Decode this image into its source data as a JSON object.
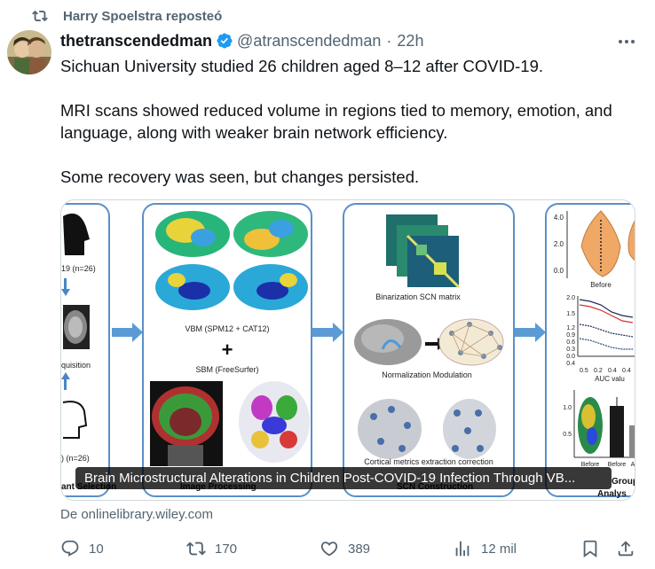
{
  "repost": {
    "text": "Harry Spoelstra reposteó",
    "icon": "repost-icon"
  },
  "author": {
    "name": "thetranscendedman",
    "handle": "@atranscendedman",
    "separator": "·",
    "time": "22h",
    "verified_color": "#1d9bf0"
  },
  "tweet": {
    "line1": "Sichuan University studied 26 children aged 8–12 after COVID-19.",
    "line2": "MRI scans showed reduced volume in regions tied to memory, emotion, and language, along with weaker brain network efficiency.",
    "line3": "Some recovery was seen, but changes persisted."
  },
  "media": {
    "caption": "Brain Microstructural Alterations in Children Post-COVID-19 Infection Through VB...",
    "figure": {
      "panel1_cohort": "19 (n=26)",
      "panel1_acquisition": "quisition",
      "panel1_n2": ") (n=26)",
      "panel1_footer": "ant Selection",
      "vbm_label": "VBM (SPM12 + CAT12)",
      "plus": "+",
      "sbm_label": "SBM (FreeSurfer)",
      "panel2_footer": "Image Processing",
      "binarization_label": "Binarization SCN matrix",
      "normalization_label": "Normalization Modulation",
      "cortical_label": "Cortical metrics extraction correction",
      "panel3_footer": "SCN Construction",
      "violin_yticks": [
        "4.0",
        "2.0",
        "0.0"
      ],
      "violin_xlabel": "Before",
      "line_yticks": [
        "2.0",
        "1.5",
        "1.2",
        "0.9",
        "0.6",
        "0.3",
        "0.0",
        "0.4"
      ],
      "line_xticks": [
        "0.5",
        "0.2",
        "0.4",
        "0.4"
      ],
      "auc_label": "AUC valu",
      "bar_yticks": [
        "1.0",
        "0.5"
      ],
      "bar_xlabels": [
        "Before",
        "Before",
        "A"
      ],
      "panel4_footer_1": "Group The",
      "panel4_footer_2": "Analys"
    }
  },
  "source": {
    "text": "De onlinelibrary.wiley.com"
  },
  "actions": {
    "replies": "10",
    "reposts": "170",
    "likes": "389",
    "views": "12 mil"
  }
}
